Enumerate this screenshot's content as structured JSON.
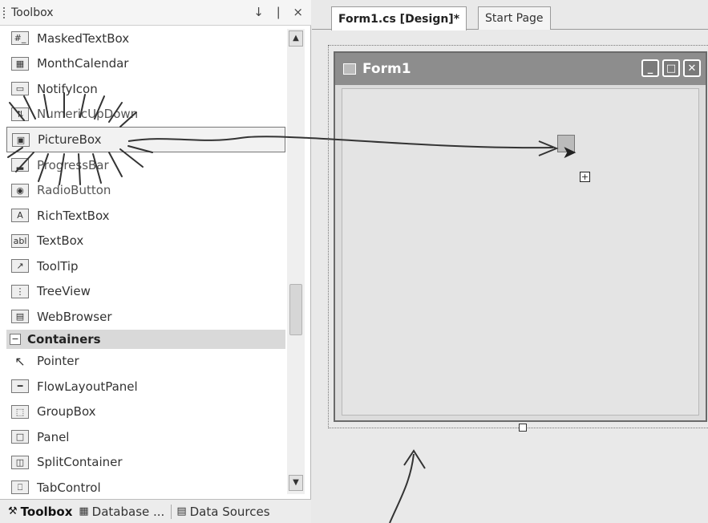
{
  "toolbox": {
    "title": "Toolbox",
    "pin": "↓",
    "autohide": "❘",
    "close": "×",
    "items": [
      {
        "label": "MaskedTextBox",
        "icon": "masked-textbox-icon",
        "glyph": "#_"
      },
      {
        "label": "MonthCalendar",
        "icon": "calendar-icon",
        "glyph": "▦"
      },
      {
        "label": "NotifyIcon",
        "icon": "notify-icon",
        "glyph": "▭"
      },
      {
        "label": "NumericUpDown",
        "icon": "numeric-updown-icon",
        "glyph": "⇅"
      },
      {
        "label": "PictureBox",
        "icon": "picturebox-icon",
        "glyph": "▣"
      },
      {
        "label": "ProgressBar",
        "icon": "progressbar-icon",
        "glyph": "▂"
      },
      {
        "label": "RadioButton",
        "icon": "radiobutton-icon",
        "glyph": "◉"
      },
      {
        "label": "RichTextBox",
        "icon": "richtextbox-icon",
        "glyph": "A"
      },
      {
        "label": "TextBox",
        "icon": "textbox-icon",
        "glyph": "abl"
      },
      {
        "label": "ToolTip",
        "icon": "tooltip-icon",
        "glyph": "↗"
      },
      {
        "label": "TreeView",
        "icon": "treeview-icon",
        "glyph": "⋮"
      },
      {
        "label": "WebBrowser",
        "icon": "webbrowser-icon",
        "glyph": "▤"
      }
    ],
    "category": {
      "label": "Containers",
      "toggle": "−"
    },
    "container_items": [
      {
        "label": "Pointer",
        "icon": "pointer-icon",
        "glyph": "↖"
      },
      {
        "label": "FlowLayoutPanel",
        "icon": "flowlayoutpanel-icon",
        "glyph": "━"
      },
      {
        "label": "GroupBox",
        "icon": "groupbox-icon",
        "glyph": "⬚"
      },
      {
        "label": "Panel",
        "icon": "panel-icon",
        "glyph": "□"
      },
      {
        "label": "SplitContainer",
        "icon": "splitcontainer-icon",
        "glyph": "◫"
      },
      {
        "label": "TabControl",
        "icon": "tabcontrol-icon",
        "glyph": "⎕"
      }
    ],
    "tabs": [
      {
        "label": "Toolbox",
        "icon": "toolbox-tab-icon",
        "glyph": "⚒"
      },
      {
        "label": "Database ...",
        "icon": "database-tab-icon",
        "glyph": "▦"
      },
      {
        "label": "Data Sources",
        "icon": "datasources-tab-icon",
        "glyph": "▤"
      }
    ]
  },
  "designer": {
    "tabs": [
      {
        "label": "Form1.cs [Design]*"
      },
      {
        "label": "Start Page"
      }
    ],
    "form": {
      "title": "Form1",
      "min": "_",
      "max": "□",
      "close": "✕"
    },
    "drop_plus": "+"
  }
}
